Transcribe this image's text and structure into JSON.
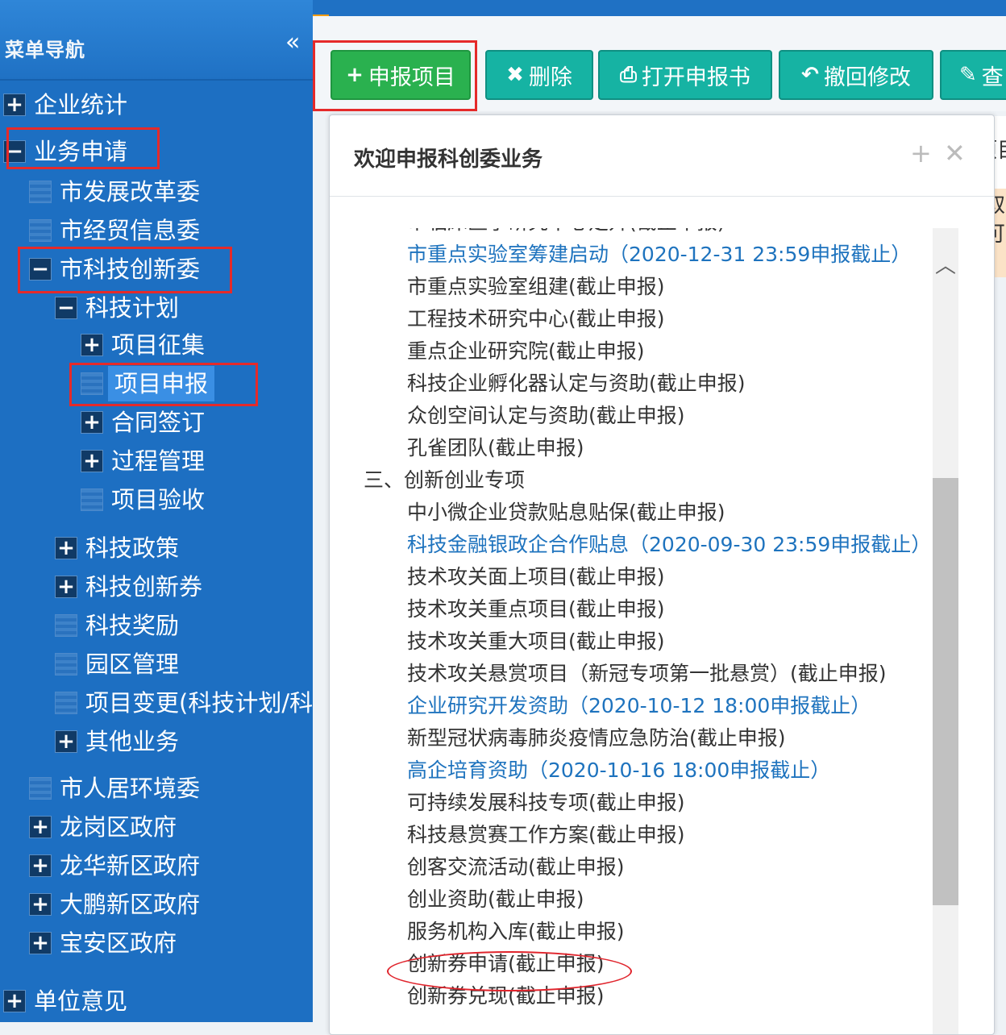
{
  "sidebar": {
    "title": "菜单导航",
    "collapse_icon": "«",
    "items": [
      {
        "label": "企业统计",
        "node": "plus"
      },
      {
        "label": "业务申请",
        "node": "minus"
      },
      {
        "label": "市发展改革委",
        "node": "leaf"
      },
      {
        "label": "市经贸信息委",
        "node": "leaf"
      },
      {
        "label": "市科技创新委",
        "node": "minus"
      },
      {
        "label": "科技计划",
        "node": "minus"
      },
      {
        "label": "项目征集",
        "node": "plus"
      },
      {
        "label": "项目申报",
        "node": "leaf",
        "selected": true
      },
      {
        "label": "合同签订",
        "node": "plus"
      },
      {
        "label": "过程管理",
        "node": "plus"
      },
      {
        "label": "项目验收",
        "node": "leaf"
      },
      {
        "label": "科技政策",
        "node": "plus"
      },
      {
        "label": "科技创新券",
        "node": "plus"
      },
      {
        "label": "科技奖励",
        "node": "leaf"
      },
      {
        "label": "园区管理",
        "node": "leaf"
      },
      {
        "label": "项目变更(科技计划/科",
        "node": "leaf"
      },
      {
        "label": "其他业务",
        "node": "plus"
      },
      {
        "label": "市人居环境委",
        "node": "leaf"
      },
      {
        "label": "龙岗区政府",
        "node": "plus"
      },
      {
        "label": "龙华新区政府",
        "node": "plus"
      },
      {
        "label": "大鹏新区政府",
        "node": "plus"
      },
      {
        "label": "宝安区政府",
        "node": "plus"
      },
      {
        "label": "单位意见",
        "node": "plus"
      }
    ]
  },
  "toolbar": {
    "buttons": [
      {
        "icon": "+",
        "label": "申报项目",
        "style": "green"
      },
      {
        "icon": "✖",
        "label": "删除",
        "style": "teal"
      },
      {
        "icon": "⎙",
        "label": "打开申报书",
        "style": "teal"
      },
      {
        "icon": "↶",
        "label": "撤回修改",
        "style": "teal"
      },
      {
        "icon": "✎",
        "label": "查",
        "style": "teal"
      }
    ]
  },
  "dialog": {
    "title": "欢迎申报科创委业务",
    "maximize_icon": "+",
    "close_icon": "✕",
    "clipped_first_line": "市临床医学研究中心定升(截止申报)",
    "lines": [
      {
        "text": "市重点实验室筹建启动（2020-12-31 23:59申报截止）",
        "type": "open"
      },
      {
        "text": "市重点实验室组建(截止申报)",
        "type": "closed"
      },
      {
        "text": "工程技术研究中心(截止申报)",
        "type": "closed"
      },
      {
        "text": "重点企业研究院(截止申报)",
        "type": "closed"
      },
      {
        "text": "科技企业孵化器认定与资助(截止申报)",
        "type": "closed"
      },
      {
        "text": "众创空间认定与资助(截止申报)",
        "type": "closed"
      },
      {
        "text": "孔雀团队(截止申报)",
        "type": "closed"
      },
      {
        "text": "三、创新创业专项",
        "type": "category"
      },
      {
        "text": "中小微企业贷款贴息贴保(截止申报)",
        "type": "closed"
      },
      {
        "text": "科技金融银政企合作贴息（2020-09-30 23:59申报截止）",
        "type": "open"
      },
      {
        "text": "技术攻关面上项目(截止申报)",
        "type": "closed"
      },
      {
        "text": "技术攻关重点项目(截止申报)",
        "type": "closed"
      },
      {
        "text": "技术攻关重大项目(截止申报)",
        "type": "closed"
      },
      {
        "text": "技术攻关悬赏项目（新冠专项第一批悬赏）(截止申报)",
        "type": "closed"
      },
      {
        "text": "企业研究开发资助（2020-10-12 18:00申报截止）",
        "type": "open"
      },
      {
        "text": "新型冠状病毒肺炎疫情应急防治(截止申报)",
        "type": "closed"
      },
      {
        "text": "高企培育资助（2020-10-16 18:00申报截止）",
        "type": "open"
      },
      {
        "text": "可持续发展科技专项(截止申报)",
        "type": "closed"
      },
      {
        "text": "科技悬赏赛工作方案(截止申报)",
        "type": "closed"
      },
      {
        "text": "创客交流活动(截止申报)",
        "type": "closed"
      },
      {
        "text": "创业资助(截止申报)",
        "type": "closed"
      },
      {
        "text": "服务机构入库(截止申报)",
        "type": "closed"
      },
      {
        "text": "创新券申请(截止申报)",
        "type": "closed",
        "circled": true
      },
      {
        "text": "创新券兑现(截止申报)",
        "type": "closed"
      }
    ]
  },
  "scrollbar": {
    "up_icon": "︿"
  },
  "right_panel": {
    "lines": [
      "项目",
      "取",
      "可服"
    ]
  },
  "colors": {
    "sidebar_bg": "#1d6fc2",
    "button_green": "#2ab14f",
    "button_teal": "#16b3a3",
    "link_blue": "#1e73be",
    "annotation_red": "#e52a2a"
  }
}
